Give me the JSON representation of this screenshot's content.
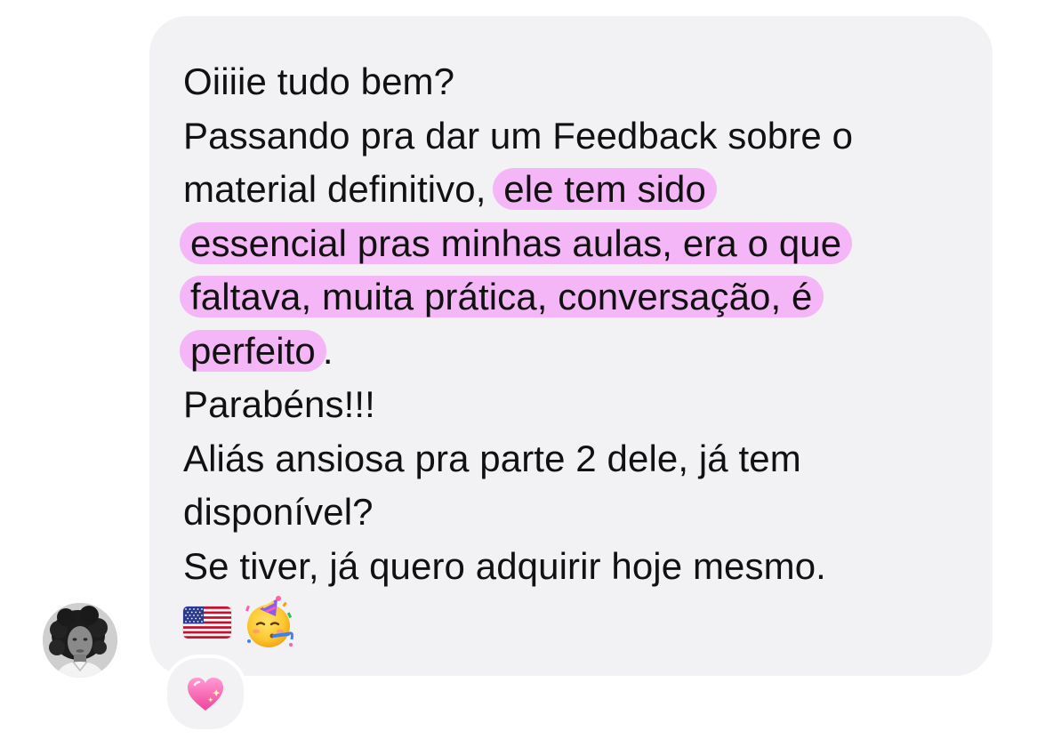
{
  "message": {
    "lines": [
      {
        "before": "Oiiiie tudo bem?",
        "highlight": "",
        "after": ""
      },
      {
        "before": "Passando pra dar um Feedback sobre o",
        "highlight": "",
        "after": ""
      },
      {
        "before": "material definitivo,",
        "highlight": "ele tem sido",
        "after": ""
      },
      {
        "before": "",
        "highlight": "essencial pras minhas aulas, era o que",
        "after": ""
      },
      {
        "before": "",
        "highlight": "faltava, muita prática, conversação, é",
        "after": ""
      },
      {
        "before": "",
        "highlight": "perfeito",
        "after": "."
      },
      {
        "before": "Parabéns!!!",
        "highlight": "",
        "after": ""
      },
      {
        "before": "Aliás ansiosa pra parte 2 dele, já tem",
        "highlight": "",
        "after": ""
      },
      {
        "before": "disponível?",
        "highlight": "",
        "after": ""
      },
      {
        "before": "Se tiver, já quero adquirir hoje mesmo.",
        "highlight": "",
        "after": ""
      }
    ],
    "emojis": [
      "us-flag-emoji",
      "partying-face-emoji"
    ],
    "highlight_color": "#f4b6f6",
    "bubble_color": "#f2f2f5",
    "text_color": "#111111"
  },
  "sender": {
    "avatar": "profile-photo"
  },
  "reaction": {
    "emoji": "sparkling-heart-emoji"
  }
}
